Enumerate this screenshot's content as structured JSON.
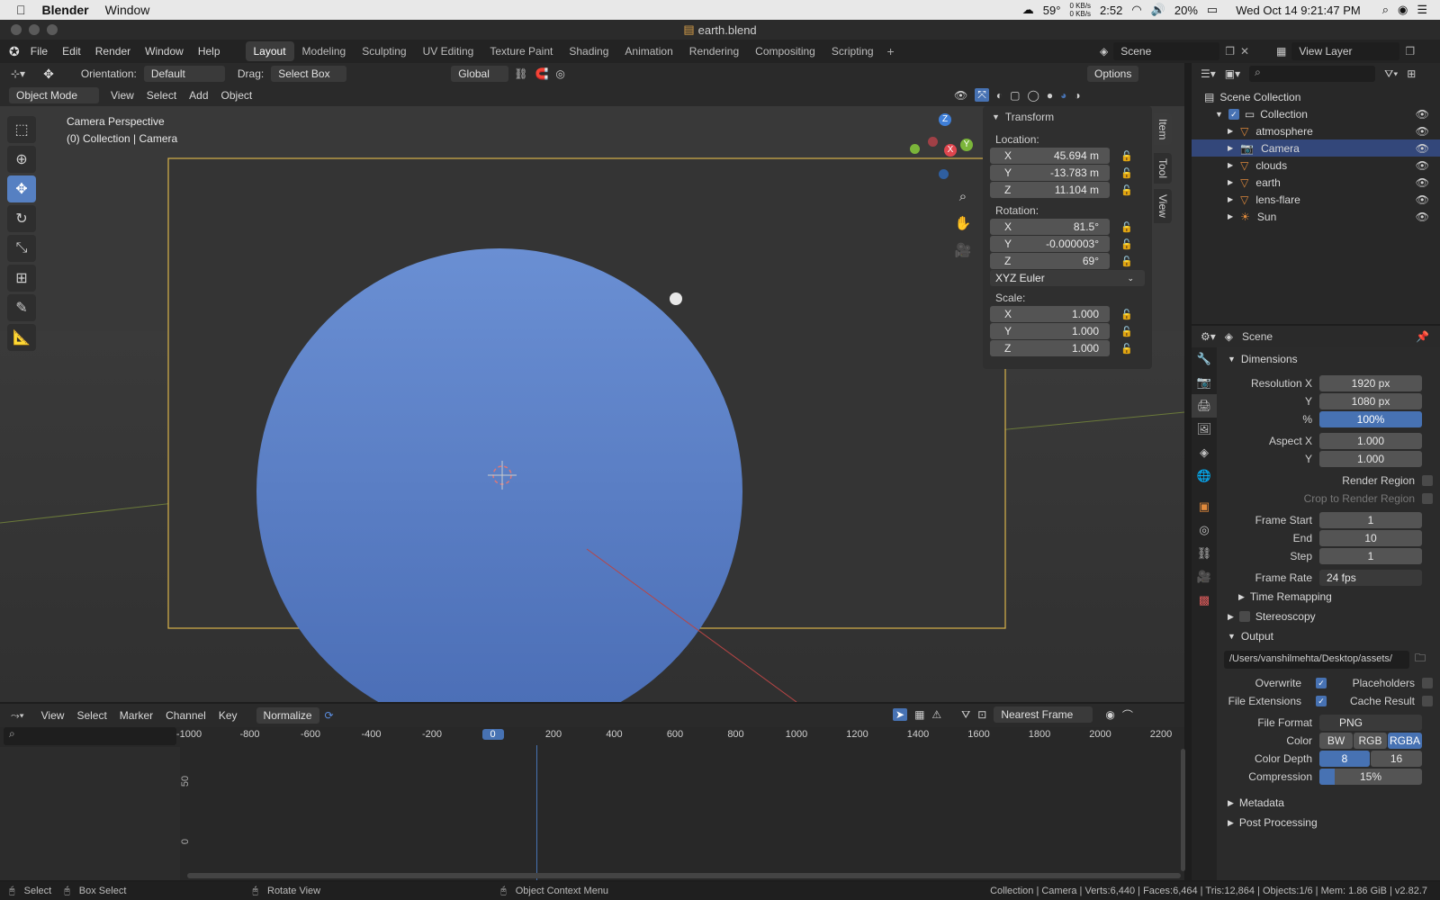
{
  "macbar": {
    "app": "Blender",
    "window_menu": "Window",
    "temp": "59°",
    "net_up": "0 KB/s",
    "net_down": "0 KB/s",
    "time_small": "2:52",
    "battery": "20%",
    "datetime": "Wed Oct 14  9:21:47 PM"
  },
  "window": {
    "title": "earth.blend"
  },
  "topbar": {
    "menus": [
      "File",
      "Edit",
      "Render",
      "Window",
      "Help"
    ],
    "workspaces": [
      "Layout",
      "Modeling",
      "Sculpting",
      "UV Editing",
      "Texture Paint",
      "Shading",
      "Animation",
      "Rendering",
      "Compositing",
      "Scripting"
    ],
    "active_workspace": "Layout",
    "scene": "Scene",
    "view_layer": "View Layer"
  },
  "toolheader": {
    "orientation_label": "Orientation:",
    "orientation_value": "Default",
    "drag_label": "Drag:",
    "drag_value": "Select Box",
    "transform_orientation": "Global",
    "options": "Options"
  },
  "viewheader": {
    "mode": "Object Mode",
    "menus": [
      "View",
      "Select",
      "Add",
      "Object"
    ]
  },
  "viewport": {
    "line1": "Camera Perspective",
    "line2": "(0) Collection | Camera",
    "gizmo_axes": [
      "Z",
      "X",
      "Y"
    ]
  },
  "npanel": {
    "title": "Transform",
    "location_label": "Location:",
    "location": [
      {
        "axis": "X",
        "value": "45.694 m"
      },
      {
        "axis": "Y",
        "value": "-13.783 m"
      },
      {
        "axis": "Z",
        "value": "11.104 m"
      }
    ],
    "rotation_label": "Rotation:",
    "rotation": [
      {
        "axis": "X",
        "value": "81.5°"
      },
      {
        "axis": "Y",
        "value": "-0.000003°"
      },
      {
        "axis": "Z",
        "value": "69°"
      }
    ],
    "rotation_mode": "XYZ Euler",
    "scale_label": "Scale:",
    "scale": [
      {
        "axis": "X",
        "value": "1.000"
      },
      {
        "axis": "Y",
        "value": "1.000"
      },
      {
        "axis": "Z",
        "value": "1.000"
      }
    ],
    "tabs": [
      "Item",
      "Tool",
      "View"
    ]
  },
  "outliner": {
    "root": "Scene Collection",
    "collection": "Collection",
    "items": [
      {
        "name": "atmosphere",
        "selected": false
      },
      {
        "name": "Camera",
        "selected": true
      },
      {
        "name": "clouds",
        "selected": false
      },
      {
        "name": "earth",
        "selected": false
      },
      {
        "name": "lens-flare",
        "selected": false
      },
      {
        "name": "Sun",
        "selected": false
      }
    ]
  },
  "properties": {
    "context": "Scene",
    "dimensions_title": "Dimensions",
    "res_x_label": "Resolution X",
    "res_x": "1920 px",
    "res_y_label": "Y",
    "res_y": "1080 px",
    "pct_label": "%",
    "pct": "100%",
    "aspect_x_label": "Aspect X",
    "aspect_x": "1.000",
    "aspect_y_label": "Y",
    "aspect_y": "1.000",
    "render_region": "Render Region",
    "crop_region": "Crop to Render Region",
    "frame_start_label": "Frame Start",
    "frame_start": "1",
    "end_label": "End",
    "end": "10",
    "step_label": "Step",
    "step": "1",
    "frame_rate_label": "Frame Rate",
    "frame_rate": "24 fps",
    "time_remapping": "Time Remapping",
    "stereoscopy": "Stereoscopy",
    "output_title": "Output",
    "output_path": "/Users/vanshilmehta/Desktop/assets/",
    "overwrite": "Overwrite",
    "placeholders": "Placeholders",
    "file_extensions": "File Extensions",
    "cache_result": "Cache Result",
    "file_format_label": "File Format",
    "file_format": "PNG",
    "color_label": "Color",
    "color_opts": [
      "BW",
      "RGB",
      "RGBA"
    ],
    "color_depth_label": "Color Depth",
    "depth_opts": [
      "8",
      "16"
    ],
    "compression_label": "Compression",
    "compression": "15%",
    "compression_fraction": 0.15,
    "metadata": "Metadata",
    "post_processing": "Post Processing"
  },
  "timeline": {
    "menus": [
      "View",
      "Select",
      "Marker",
      "Channel",
      "Key"
    ],
    "normalize": "Normalize",
    "snap": "Nearest Frame",
    "ruler": [
      "-1000",
      "-800",
      "-600",
      "-400",
      "-200",
      "0",
      "200",
      "400",
      "600",
      "800",
      "1000",
      "1200",
      "1400",
      "1600",
      "1800",
      "2000",
      "2200"
    ],
    "current_frame": "0",
    "y_labels": [
      "50",
      "0"
    ]
  },
  "statusbar": {
    "select": "Select",
    "box_select": "Box Select",
    "rotate_view": "Rotate View",
    "context_menu": "Object Context Menu",
    "info": "Collection | Camera | Verts:6,440 | Faces:6,464 | Tris:12,864 | Objects:1/6 | Mem: 1.86 GiB | v2.82.7"
  },
  "colors": {
    "accent": "#4772b3",
    "sphere": "#5f85cc",
    "selection": "#33477a",
    "camera_frame": "#d8b24a"
  }
}
